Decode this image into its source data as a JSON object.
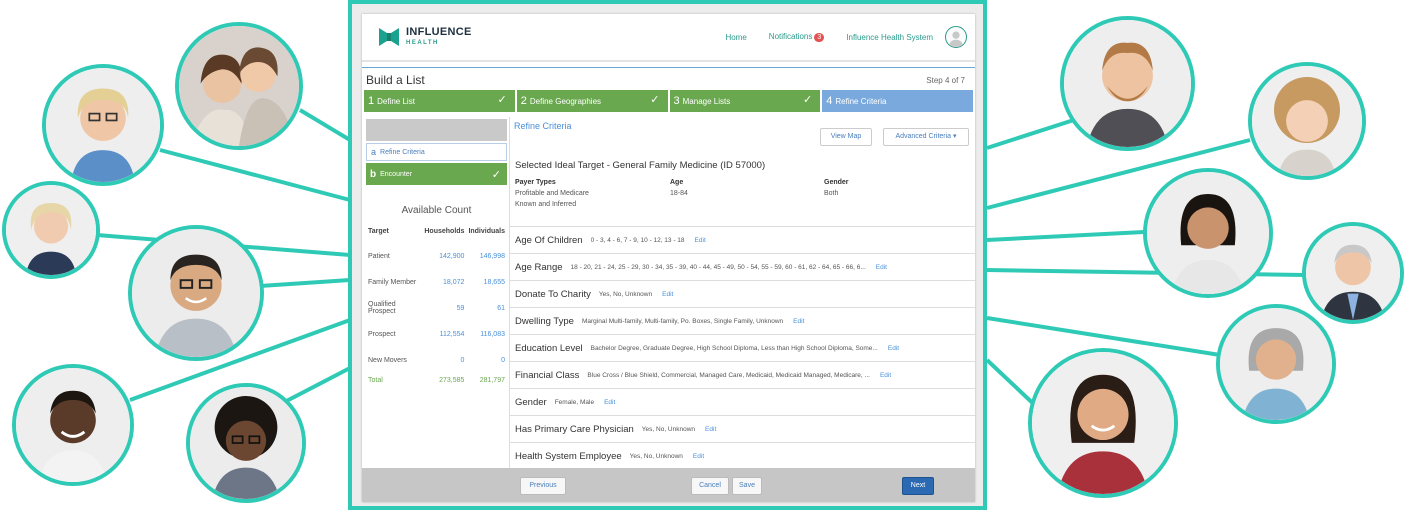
{
  "header": {
    "logo_title": "INFLUENCE",
    "logo_sub": "HEALTH",
    "nav_home": "Home",
    "nav_notifications": "Notifications",
    "notification_count": "3",
    "nav_system": "Influence Health System"
  },
  "page": {
    "title": "Build a List",
    "step_count": "Step 4 of 7"
  },
  "steps": [
    {
      "num": "1",
      "label": "Define List",
      "done": true
    },
    {
      "num": "2",
      "label": "Define Geographies",
      "done": true
    },
    {
      "num": "3",
      "label": "Manage Lists",
      "done": true
    },
    {
      "num": "4",
      "label": "Refine Criteria",
      "done": false
    }
  ],
  "left": {
    "sub_a_letter": "a",
    "sub_a_label": "Refine Criteria",
    "sub_b_letter": "b",
    "sub_b_label": "Encounter",
    "available_title": "Available Count",
    "columns": [
      "Target",
      "Households",
      "Individuals"
    ],
    "rows": [
      {
        "target": "Patient",
        "households": "142,900",
        "individuals": "146,998"
      },
      {
        "target": "Family Member",
        "households": "18,072",
        "individuals": "18,655"
      },
      {
        "target": "Qualified Prospect",
        "households": "59",
        "individuals": "61"
      },
      {
        "target": "Prospect",
        "households": "112,554",
        "individuals": "116,083"
      },
      {
        "target": "New Movers",
        "households": "0",
        "individuals": "0"
      }
    ],
    "total": {
      "target": "Total",
      "households": "273,585",
      "individuals": "281,797"
    }
  },
  "right": {
    "heading": "Refine Criteria",
    "view_map": "View Map",
    "advanced_criteria": "Advanced Criteria ▾",
    "target_title": "Selected Ideal Target - General Family Medicine (ID 57000)",
    "payer_label": "Payer Types",
    "payer_line1": "Profitable and Medicare",
    "payer_line2": "Known and Inferred",
    "age_label": "Age",
    "age_value": "18-84",
    "gender_label": "Gender",
    "gender_value": "Both",
    "edit_label": "Edit",
    "criteria": [
      {
        "label": "Age Of Children",
        "value": "0 - 3, 4 - 6, 7 - 9, 10 - 12, 13 - 18"
      },
      {
        "label": "Age Range",
        "value": "18 - 20, 21 - 24, 25 - 29, 30 - 34, 35 - 39, 40 - 44, 45 - 49, 50 - 54, 55 - 59, 60 - 61, 62 - 64, 65 - 66, 6..."
      },
      {
        "label": "Donate To Charity",
        "value": "Yes, No, Unknown"
      },
      {
        "label": "Dwelling Type",
        "value": "Marginal Multi-family, Multi-family, Po. Boxes, Single Family, Unknown"
      },
      {
        "label": "Education Level",
        "value": "Bachelor Degree, Graduate Degree, High School Diploma, Less than High School Diploma, Some..."
      },
      {
        "label": "Financial Class",
        "value": "Blue Cross / Blue Shield, Commercial, Managed Care, Medicaid, Medicaid Managed, Medicare, ..."
      },
      {
        "label": "Gender",
        "value": "Female, Male"
      },
      {
        "label": "Has Primary Care Physician",
        "value": "Yes, No, Unknown"
      },
      {
        "label": "Health System Employee",
        "value": "Yes, No, Unknown"
      }
    ]
  },
  "footer": {
    "previous": "Previous",
    "cancel": "Cancel",
    "save": "Save",
    "next": "Next"
  },
  "colors": {
    "accent_teal": "#2fcab5",
    "step_done_green": "#6aa84f",
    "step_active_blue": "#7aa9dd",
    "link_blue": "#4a90d9",
    "primary_button": "#2c69b3"
  }
}
